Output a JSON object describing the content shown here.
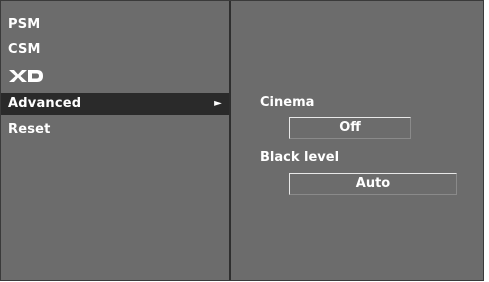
{
  "menu": {
    "items": [
      {
        "label": "PSM"
      },
      {
        "label": "CSM"
      },
      {
        "label": "XD",
        "logo": true
      },
      {
        "label": "Advanced",
        "selected": true,
        "submenu_indicator": "►"
      },
      {
        "label": "Reset"
      }
    ]
  },
  "advanced": {
    "cinema": {
      "label": "Cinema",
      "value": "Off"
    },
    "black_level": {
      "label": "Black level",
      "value": "Auto"
    }
  }
}
